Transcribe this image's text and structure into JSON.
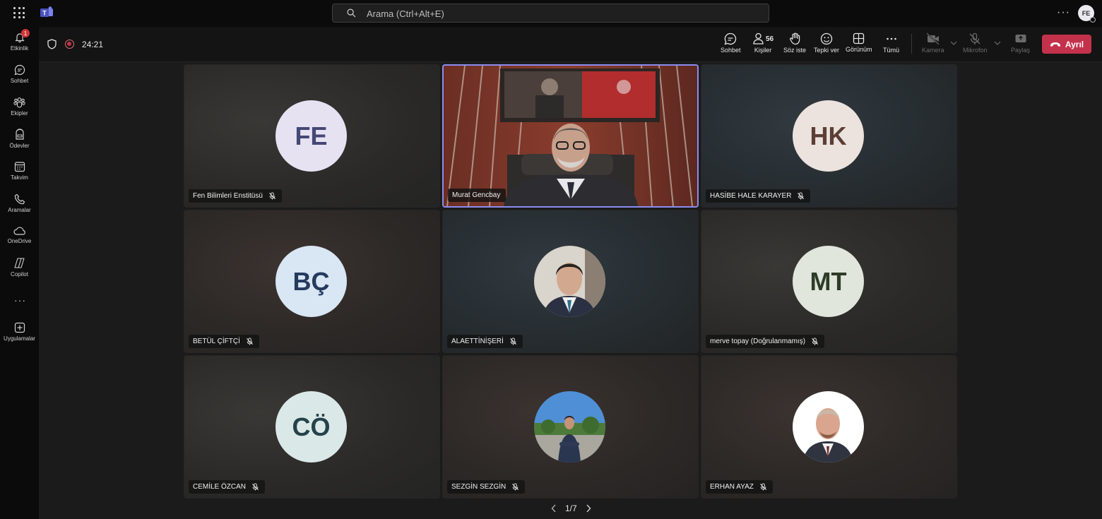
{
  "search": {
    "placeholder": "Arama (Ctrl+Alt+E)"
  },
  "user": {
    "initials": "FE"
  },
  "rail": {
    "items": [
      {
        "label": "Etkinlik",
        "badge": "1"
      },
      {
        "label": "Sohbet"
      },
      {
        "label": "Ekipler"
      },
      {
        "label": "Ödevler"
      },
      {
        "label": "Takvim"
      },
      {
        "label": "Aramalar"
      },
      {
        "label": "OneDrive"
      },
      {
        "label": "Copilot"
      },
      {
        "label": "Uygulamalar"
      }
    ]
  },
  "meeting": {
    "timer": "24:21",
    "participant_count": "56",
    "controls": {
      "chat": "Sohbet",
      "people": "Kişiler",
      "raise_hand": "Söz iste",
      "react": "Tepki ver",
      "view": "Görünüm",
      "more": "Tümü",
      "camera": "Kamera",
      "mic": "Mikrofon",
      "share": "Paylaş",
      "leave": "Ayrıl"
    },
    "pager": "1/7",
    "tiles": [
      {
        "name": "Fen Bilimleri Enstitüsü",
        "initials": "FE"
      },
      {
        "name": "Murat Gencbay"
      },
      {
        "name": "HASİBE HALE KARAYER",
        "initials": "HK"
      },
      {
        "name": "BETÜL ÇİFTÇİ",
        "initials": "BÇ"
      },
      {
        "name": "ALAETTİNİŞERİ"
      },
      {
        "name": "merve topay (Doğrulanmamış)",
        "initials": "MT"
      },
      {
        "name": "CEMİLE ÖZCAN",
        "initials": "CÖ"
      },
      {
        "name": "SEZGİN SEZGİN"
      },
      {
        "name": "ERHAN AYAZ"
      }
    ]
  },
  "colors": {
    "leave": "#c4314b",
    "speaking_border": "#8b8cf0",
    "avatar_fe": "#e6e2f2",
    "avatar_hk": "#ece2de",
    "avatar_bc": "#d9e6f3",
    "avatar_mt": "#e0e6dc",
    "avatar_co": "#dbe8e8"
  }
}
